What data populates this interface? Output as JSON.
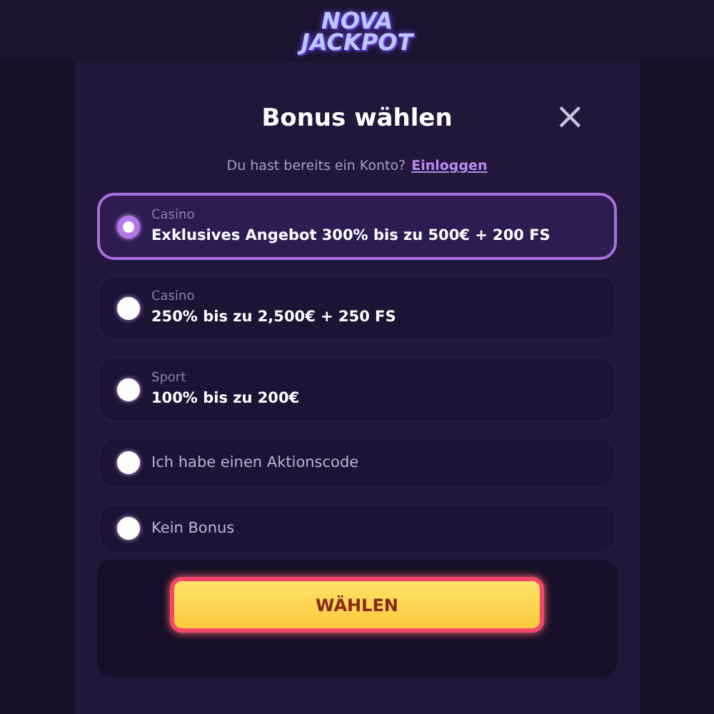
{
  "logo": {
    "line_1": "NOVA",
    "line_2": "JACKPOT"
  },
  "title": "Bonus wählen",
  "close": "×",
  "login_prompt": {
    "text": "Du hast bereits ein Konto?",
    "link": "Einloggen"
  },
  "options": [
    {
      "category": "Casino",
      "label": "Exklusives Angebot 300% bis zu 500€ + 200 FS",
      "selected": true
    },
    {
      "category": "Casino",
      "label": "250% bis zu 2,500€ + 250 FS",
      "selected": false
    },
    {
      "category": "Sport",
      "label": "100% bis zu 200€",
      "selected": false
    },
    {
      "label": "Ich habe einen Aktionscode",
      "selected": false
    },
    {
      "label": "Kein Bonus",
      "selected": false
    }
  ],
  "button": "WÄHLEN"
}
